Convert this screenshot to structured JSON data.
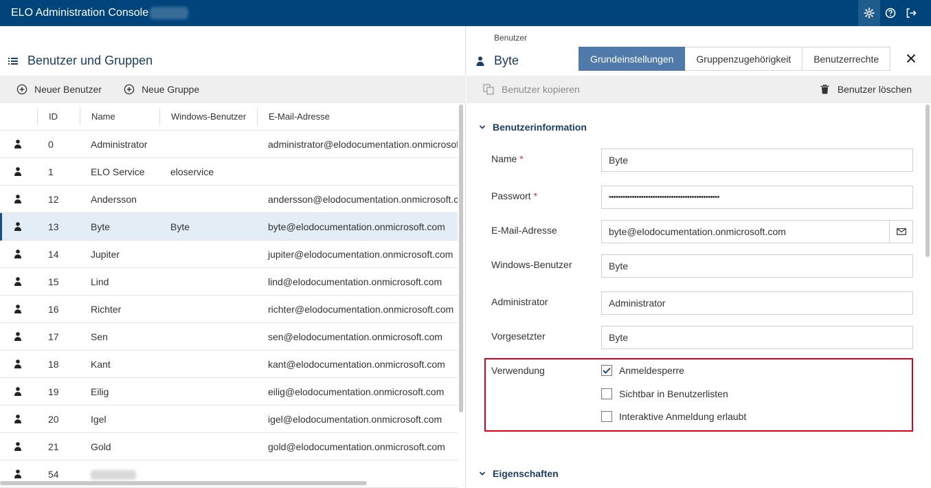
{
  "app": {
    "title": "ELO Administration Console"
  },
  "left_panel": {
    "title": "Benutzer und Gruppen",
    "toolbar": {
      "new_user": "Neuer Benutzer",
      "new_group": "Neue Gruppe"
    },
    "columns": [
      "ID",
      "Name",
      "Windows-Benutzer",
      "E-Mail-Adresse"
    ],
    "rows": [
      {
        "id": "0",
        "name": "Administrator",
        "windows": "",
        "mail": "administrator@elodocumentation.onmicrosoft.com"
      },
      {
        "id": "1",
        "name": "ELO Service",
        "windows": "eloservice",
        "mail": ""
      },
      {
        "id": "12",
        "name": "Andersson",
        "windows": "",
        "mail": "andersson@elodocumentation.onmicrosoft.com"
      },
      {
        "id": "13",
        "name": "Byte",
        "windows": "Byte",
        "mail": "byte@elodocumentation.onmicrosoft.com"
      },
      {
        "id": "14",
        "name": "Jupiter",
        "windows": "",
        "mail": "jupiter@elodocumentation.onmicrosoft.com"
      },
      {
        "id": "15",
        "name": "Lind",
        "windows": "",
        "mail": "lind@elodocumentation.onmicrosoft.com"
      },
      {
        "id": "16",
        "name": "Richter",
        "windows": "",
        "mail": "richter@elodocumentation.onmicrosoft.com"
      },
      {
        "id": "17",
        "name": "Sen",
        "windows": "",
        "mail": "sen@elodocumentation.onmicrosoft.com"
      },
      {
        "id": "18",
        "name": "Kant",
        "windows": "",
        "mail": "kant@elodocumentation.onmicrosoft.com"
      },
      {
        "id": "19",
        "name": "Eilig",
        "windows": "",
        "mail": "eilig@elodocumentation.onmicrosoft.com"
      },
      {
        "id": "20",
        "name": "Igel",
        "windows": "",
        "mail": "igel@elodocumentation.onmicrosoft.com"
      },
      {
        "id": "21",
        "name": "Gold",
        "windows": "",
        "mail": "gold@elodocumentation.onmicrosoft.com"
      },
      {
        "id": "54",
        "name": "",
        "windows": "",
        "mail": ""
      }
    ],
    "selected_row": 3
  },
  "right_panel": {
    "breadcrumb": "Benutzer",
    "title": "Byte",
    "tabs": [
      "Grundeinstellungen",
      "Gruppenzugehörigkeit",
      "Benutzerrechte"
    ],
    "active_tab": 0,
    "toolbar": {
      "copy": "Benutzer kopieren",
      "delete": "Benutzer löschen"
    },
    "section_info": "Benutzerinformation",
    "fields": {
      "name_label": "Name",
      "name_value": "Byte",
      "password_label": "Passwort",
      "password_value": "••••••••••••••••••••••••••••••••••••••••••••••••",
      "email_label": "E-Mail-Adresse",
      "email_value": "byte@elodocumentation.onmicrosoft.com",
      "windows_label": "Windows-Benutzer",
      "windows_value": "Byte",
      "admin_label": "Administrator",
      "admin_value": "Administrator",
      "supervisor_label": "Vorgesetzter",
      "supervisor_value": "Byte",
      "required_mark": "*"
    },
    "usage": {
      "label": "Verwendung",
      "options": [
        {
          "label": "Anmeldesperre",
          "checked": true
        },
        {
          "label": "Sichtbar in Benutzerlisten",
          "checked": false
        },
        {
          "label": "Interaktive Anmeldung erlaubt",
          "checked": false
        }
      ]
    },
    "section_props": "Eigenschaften"
  },
  "colors": {
    "topbar": "#00447c",
    "accent": "#4f7aa9",
    "heading": "#1a3e66",
    "highlight": "#e0001b"
  }
}
